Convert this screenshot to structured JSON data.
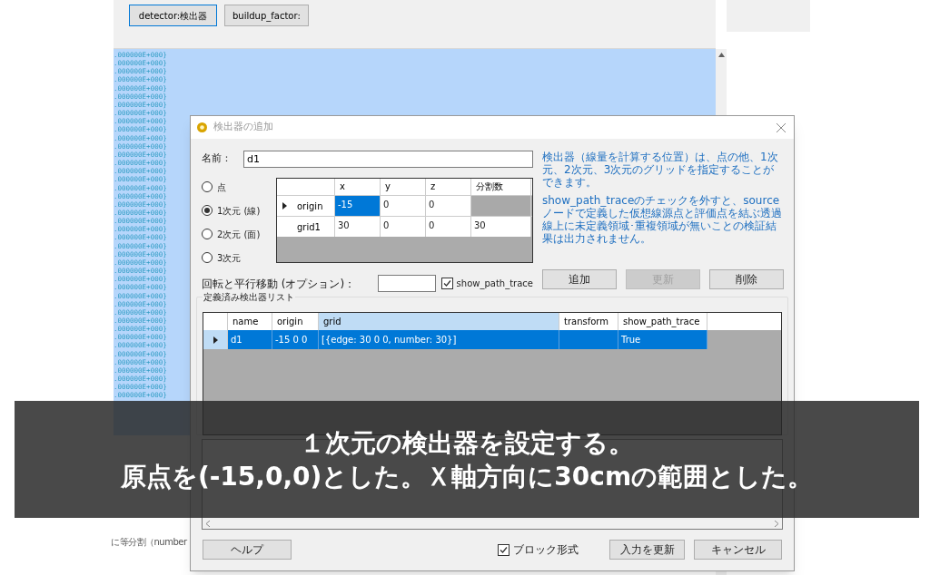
{
  "toolbar": {
    "buttons": [
      {
        "label": "detector:検出器",
        "selected": true
      },
      {
        "label": "buildup_factor:",
        "selected": false
      }
    ]
  },
  "editor": {
    "lines": [
      ".000000E+000}",
      ".000000E+000}",
      ".000000E+000}",
      ".000000E+000}",
      ".000000E+000}",
      ".000000E+000}",
      ".000000E+000}",
      ".000000E+000}",
      ".000000E+000}",
      ".000000E+000}",
      ".000000E+000}",
      ".000000E+000}",
      ".000000E+000}",
      ".000000E+000}",
      ".000000E+000}",
      ".000000E+000}",
      ".000000E+000}",
      ".000000E+000}",
      ".000000E+000}",
      ".000000E+000}",
      ".000000E+000}",
      ".000000E+000}",
      ".000000E+000}",
      ".000000E+000}",
      ".000000E+000}",
      ".000000E+000}",
      ".000000E+000}",
      ".000000E+000}",
      ".000000E+000}",
      ".000000E+000}",
      ".000000E+000}",
      ".000000E+000}",
      ".000000E+000}",
      ".000000E+000}",
      ".000000E+000}",
      ".000000E+000}",
      ".000000E+000}",
      ".000000E+000}",
      ".000000E+000}",
      ".000000E+000}",
      ".000000E+000}",
      ".000000E+000}"
    ]
  },
  "background_note": "に等分割（number",
  "dialog": {
    "title": "検出器の追加",
    "name_label": "名前：",
    "name_value": "d1",
    "help_paragraphs": [
      "検出器（線量を計算する位置）は、点の他、1次元、2次元、3次元のグリッドを指定することができます。",
      "show_path_traceのチェックを外すと、sourceノードで定義した仮想線源点と評価点を結ぶ透過線上に未定義領域･重複領域が無いことの検証結果は出力されません。"
    ],
    "radios": [
      {
        "label": "点",
        "selected": false
      },
      {
        "label": "1次元 (線)",
        "selected": true
      },
      {
        "label": "2次元 (面)",
        "selected": false
      },
      {
        "label": "3次元",
        "selected": false
      }
    ],
    "point_grid": {
      "columns": [
        "x",
        "y",
        "z",
        "分割数"
      ],
      "rows": [
        {
          "label": "origin",
          "current": true,
          "cells": [
            {
              "text": "-15",
              "selected": true
            },
            {
              "text": "0",
              "selected": false
            },
            {
              "text": "0",
              "selected": false
            },
            null
          ]
        },
        {
          "label": "grid1",
          "current": false,
          "cells": [
            {
              "text": "30",
              "selected": false
            },
            {
              "text": "0",
              "selected": false
            },
            {
              "text": "0",
              "selected": false
            },
            {
              "text": "30",
              "selected": false
            }
          ]
        }
      ]
    },
    "transform_label": "回転と平行移動 (オプション)：",
    "show_path_trace": {
      "label": "show_path_trace",
      "checked": true
    },
    "action_buttons": [
      {
        "label": "追加",
        "disabled": false
      },
      {
        "label": "更新",
        "disabled": true
      },
      {
        "label": "削除",
        "disabled": false
      }
    ],
    "list": {
      "title": "定義済み検出器リスト",
      "columns": [
        {
          "label": "name",
          "selected": false
        },
        {
          "label": "origin",
          "selected": false
        },
        {
          "label": "grid",
          "selected": true
        },
        {
          "label": "transform",
          "selected": false
        },
        {
          "label": "show_path_trace",
          "selected": false
        }
      ],
      "rows": [
        {
          "selected": true,
          "current": true,
          "cells": [
            "d1",
            "-15 0 0",
            "[{edge: 30 0 0, number: 30}]",
            null,
            "True"
          ]
        }
      ]
    },
    "help_button": "ヘルプ",
    "block_format": {
      "label": "ブロック形式",
      "checked": true
    },
    "footer_buttons": [
      "入力を更新",
      "キャンセル"
    ]
  },
  "caption": {
    "lines": [
      "１次元の検出器を設定する。",
      "原点を(-15,0,0)とした。Ｘ軸方向に30cmの範囲とした。"
    ]
  }
}
